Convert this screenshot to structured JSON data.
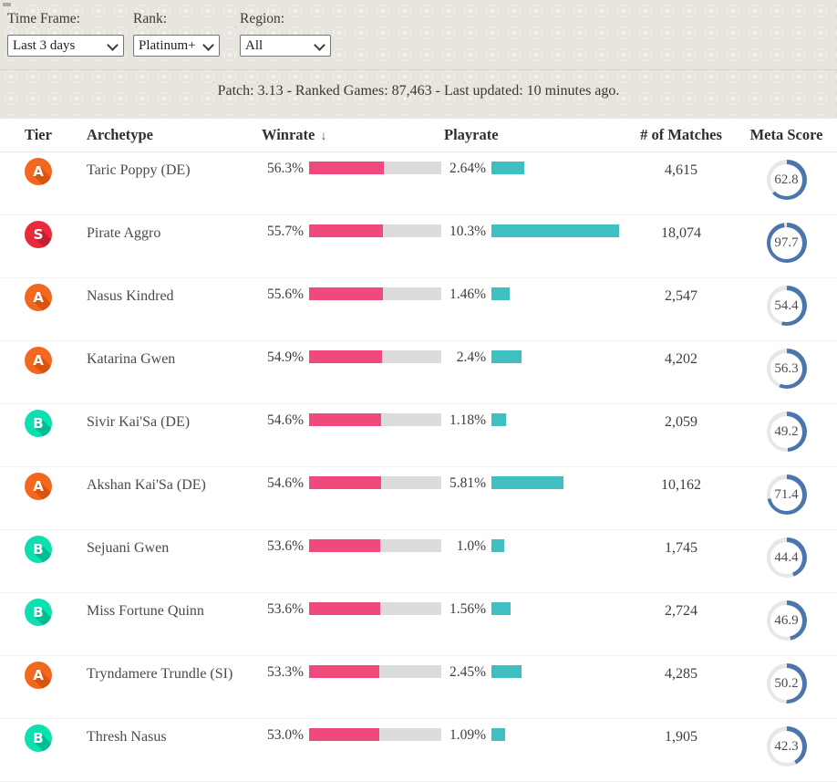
{
  "filters": {
    "time_frame": {
      "label": "Time Frame:",
      "value": "Last 3 days"
    },
    "rank": {
      "label": "Rank:",
      "value": "Platinum+"
    },
    "region": {
      "label": "Region:",
      "value": "All"
    }
  },
  "status_bar": {
    "text": "Patch: 3.13 - Ranked Games: 87,463 - Last updated: 10 minutes ago."
  },
  "table": {
    "columns": {
      "tier": "Tier",
      "archetype": "Archetype",
      "winrate": "Winrate",
      "sort_icon": "↓",
      "playrate": "Playrate",
      "matches": "# of Matches",
      "meta_score": "Meta Score"
    },
    "playrate_axis_max": 10.3,
    "rows": [
      {
        "tier": "A",
        "archetype": "Taric Poppy (DE)",
        "winrate": "56.3%",
        "winrate_value": 56.3,
        "playrate": "2.64%",
        "playrate_value": 2.64,
        "matches": "4,615",
        "meta_score": "62.8",
        "meta_score_value": 62.8
      },
      {
        "tier": "S",
        "archetype": "Pirate Aggro",
        "winrate": "55.7%",
        "winrate_value": 55.7,
        "playrate": "10.3%",
        "playrate_value": 10.3,
        "matches": "18,074",
        "meta_score": "97.7",
        "meta_score_value": 97.7
      },
      {
        "tier": "A",
        "archetype": "Nasus Kindred",
        "winrate": "55.6%",
        "winrate_value": 55.6,
        "playrate": "1.46%",
        "playrate_value": 1.46,
        "matches": "2,547",
        "meta_score": "54.4",
        "meta_score_value": 54.4
      },
      {
        "tier": "A",
        "archetype": "Katarina Gwen",
        "winrate": "54.9%",
        "winrate_value": 54.9,
        "playrate": "2.4%",
        "playrate_value": 2.4,
        "matches": "4,202",
        "meta_score": "56.3",
        "meta_score_value": 56.3
      },
      {
        "tier": "B",
        "archetype": "Sivir Kai'Sa (DE)",
        "winrate": "54.6%",
        "winrate_value": 54.6,
        "playrate": "1.18%",
        "playrate_value": 1.18,
        "matches": "2,059",
        "meta_score": "49.2",
        "meta_score_value": 49.2
      },
      {
        "tier": "A",
        "archetype": "Akshan Kai'Sa (DE)",
        "winrate": "54.6%",
        "winrate_value": 54.6,
        "playrate": "5.81%",
        "playrate_value": 5.81,
        "matches": "10,162",
        "meta_score": "71.4",
        "meta_score_value": 71.4
      },
      {
        "tier": "B",
        "archetype": "Sejuani Gwen",
        "winrate": "53.6%",
        "winrate_value": 53.6,
        "playrate": "1.0%",
        "playrate_value": 1.0,
        "matches": "1,745",
        "meta_score": "44.4",
        "meta_score_value": 44.4
      },
      {
        "tier": "B",
        "archetype": "Miss Fortune Quinn",
        "winrate": "53.6%",
        "winrate_value": 53.6,
        "playrate": "1.56%",
        "playrate_value": 1.56,
        "matches": "2,724",
        "meta_score": "46.9",
        "meta_score_value": 46.9
      },
      {
        "tier": "A",
        "archetype": "Tryndamere Trundle (SI)",
        "winrate": "53.3%",
        "winrate_value": 53.3,
        "playrate": "2.45%",
        "playrate_value": 2.45,
        "matches": "4,285",
        "meta_score": "50.2",
        "meta_score_value": 50.2
      },
      {
        "tier": "B",
        "archetype": "Thresh Nasus",
        "winrate": "53.0%",
        "winrate_value": 53.0,
        "playrate": "1.09%",
        "playrate_value": 1.09,
        "matches": "1,905",
        "meta_score": "42.3",
        "meta_score_value": 42.3
      }
    ]
  },
  "colors": {
    "winrate_bar": "#f0497c",
    "winrate_track": "#dcdcdc",
    "playrate_bar": "#3fbfc1",
    "ring": "#4a76ab",
    "ring_track": "#e7e7e7",
    "tier_S": {
      "bg": "#e82c3c",
      "shadow": "#c51f30"
    },
    "tier_A": {
      "bg": "#f4671e",
      "shadow": "#d85510"
    },
    "tier_B": {
      "bg": "#0cdfb0",
      "shadow": "#00bd92"
    }
  }
}
